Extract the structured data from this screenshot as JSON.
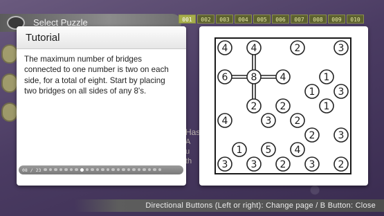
{
  "background": {
    "header_label": "Select Puzzle",
    "tabs": [
      "001",
      "002",
      "003",
      "004",
      "005",
      "006",
      "007",
      "008",
      "009",
      "010"
    ],
    "active_tab_index": 0,
    "under_text": [
      "Has",
      "A",
      "u",
      "th"
    ]
  },
  "tutorial": {
    "title": "Tutorial",
    "body": "The maximum number of bridges connected to one number is two on each side, for a total of eight. Start by placing two bridges on all sides of any 8's.",
    "page_label": "08 / 23",
    "current_page": 8,
    "total_pages": 23
  },
  "puzzle": {
    "grid_cols": 9,
    "grid_rows": 9,
    "islands": [
      {
        "col": 0,
        "row": 0,
        "value": "4"
      },
      {
        "col": 2,
        "row": 0,
        "value": "4"
      },
      {
        "col": 5,
        "row": 0,
        "value": "2"
      },
      {
        "col": 8,
        "row": 0,
        "value": "3"
      },
      {
        "col": 0,
        "row": 2,
        "value": "6"
      },
      {
        "col": 2,
        "row": 2,
        "value": "8"
      },
      {
        "col": 4,
        "row": 2,
        "value": "4"
      },
      {
        "col": 7,
        "row": 2,
        "value": "1"
      },
      {
        "col": 6,
        "row": 3,
        "value": "1"
      },
      {
        "col": 8,
        "row": 3,
        "value": "3"
      },
      {
        "col": 2,
        "row": 4,
        "value": "2"
      },
      {
        "col": 4,
        "row": 4,
        "value": "2"
      },
      {
        "col": 7,
        "row": 4,
        "value": "1"
      },
      {
        "col": 0,
        "row": 5,
        "value": "4"
      },
      {
        "col": 3,
        "row": 5,
        "value": "3"
      },
      {
        "col": 5,
        "row": 5,
        "value": "2"
      },
      {
        "col": 6,
        "row": 6,
        "value": "2"
      },
      {
        "col": 8,
        "row": 6,
        "value": "3"
      },
      {
        "col": 1,
        "row": 7,
        "value": "1"
      },
      {
        "col": 3,
        "row": 7,
        "value": "5"
      },
      {
        "col": 5,
        "row": 7,
        "value": "4"
      },
      {
        "col": 0,
        "row": 8,
        "value": "3"
      },
      {
        "col": 2,
        "row": 8,
        "value": "3"
      },
      {
        "col": 4,
        "row": 8,
        "value": "2"
      },
      {
        "col": 6,
        "row": 8,
        "value": "3"
      },
      {
        "col": 8,
        "row": 8,
        "value": "2"
      }
    ],
    "bridges": [
      {
        "from": [
          2,
          2
        ],
        "to": [
          2,
          0
        ],
        "count": 2
      },
      {
        "from": [
          2,
          2
        ],
        "to": [
          0,
          2
        ],
        "count": 2
      },
      {
        "from": [
          2,
          2
        ],
        "to": [
          4,
          2
        ],
        "count": 2
      },
      {
        "from": [
          2,
          2
        ],
        "to": [
          2,
          4
        ],
        "count": 2
      }
    ]
  },
  "hint": {
    "text": "Directional Buttons (Left or right): Change page / B Button: Close"
  },
  "colors": {
    "card": "#ffffff",
    "island_stroke": "#222222",
    "grid_border": "#1a1a1a",
    "tab_active": "#a6ad4a"
  }
}
